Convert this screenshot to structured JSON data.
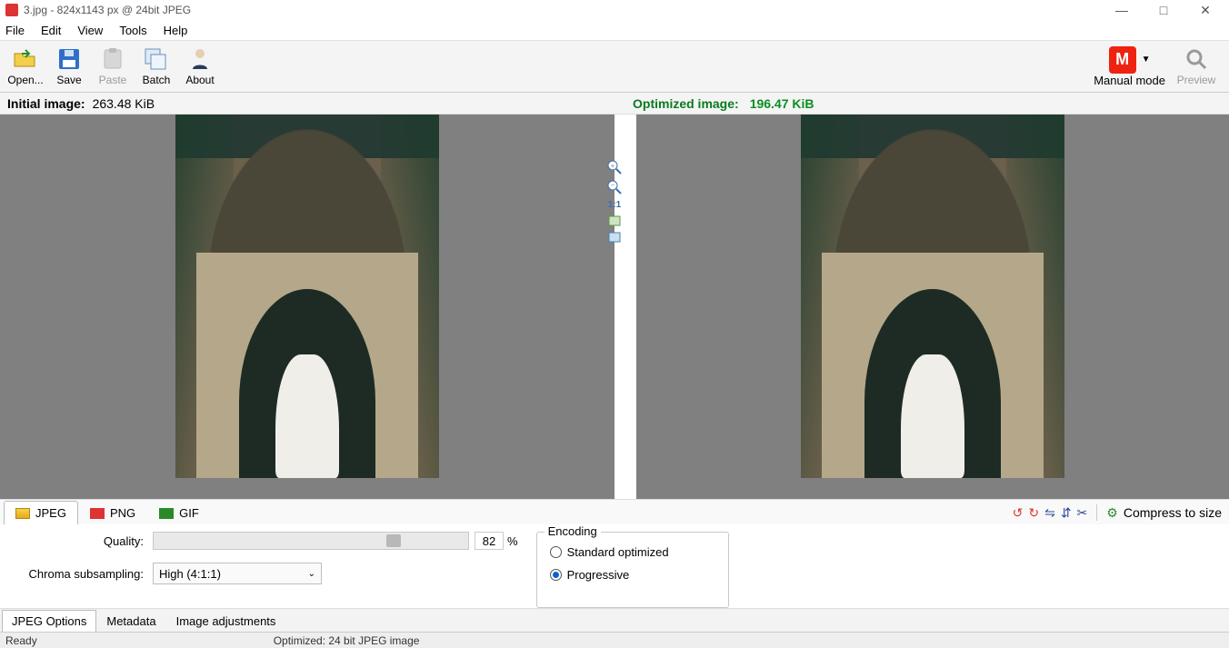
{
  "window": {
    "title": "3.jpg - 824x1143 px @ 24bit JPEG"
  },
  "menu": {
    "file": "File",
    "edit": "Edit",
    "view": "View",
    "tools": "Tools",
    "help": "Help"
  },
  "toolbar": {
    "open": "Open...",
    "save": "Save",
    "paste": "Paste",
    "batch": "Batch",
    "about": "About",
    "mode_letter": "M",
    "mode_label": "Manual mode",
    "preview": "Preview"
  },
  "info": {
    "initial_label": "Initial image:",
    "initial_size": "263.48 KiB",
    "optimized_label": "Optimized image:",
    "optimized_size": "196.47 KiB"
  },
  "zoom": {
    "one_to_one": "1:1"
  },
  "format_tabs": {
    "jpeg": "JPEG",
    "png": "PNG",
    "gif": "GIF"
  },
  "tools_row": {
    "compress": "Compress to size"
  },
  "options": {
    "quality_label": "Quality:",
    "quality_value": "82",
    "quality_pct": "%",
    "chroma_label": "Chroma subsampling:",
    "chroma_value": "High (4:1:1)"
  },
  "encoding": {
    "legend": "Encoding",
    "standard": "Standard optimized",
    "progressive": "Progressive"
  },
  "bottom_tabs": {
    "jpeg_options": "JPEG Options",
    "metadata": "Metadata",
    "image_adj": "Image adjustments"
  },
  "status": {
    "ready": "Ready",
    "optimized": "Optimized: 24 bit JPEG image"
  }
}
